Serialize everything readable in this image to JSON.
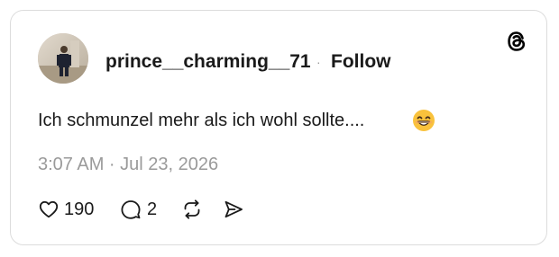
{
  "post": {
    "username": "prince__charming__71",
    "separator": "·",
    "follow_label": "Follow",
    "text": "Ich schmunzel mehr als ich wohl sollte....",
    "emoji": "😁",
    "timestamp": "3:07 AM · Jul 23, 2026"
  },
  "actions": {
    "likes": "190",
    "replies": "2"
  },
  "icons": {
    "brand": "threads-logo-icon",
    "like": "heart-icon",
    "reply": "comment-icon",
    "repost": "repost-icon",
    "share": "send-icon"
  },
  "colors": {
    "text": "#1a1a1a",
    "muted": "#9a9a9a",
    "border": "#dcdcdc"
  }
}
